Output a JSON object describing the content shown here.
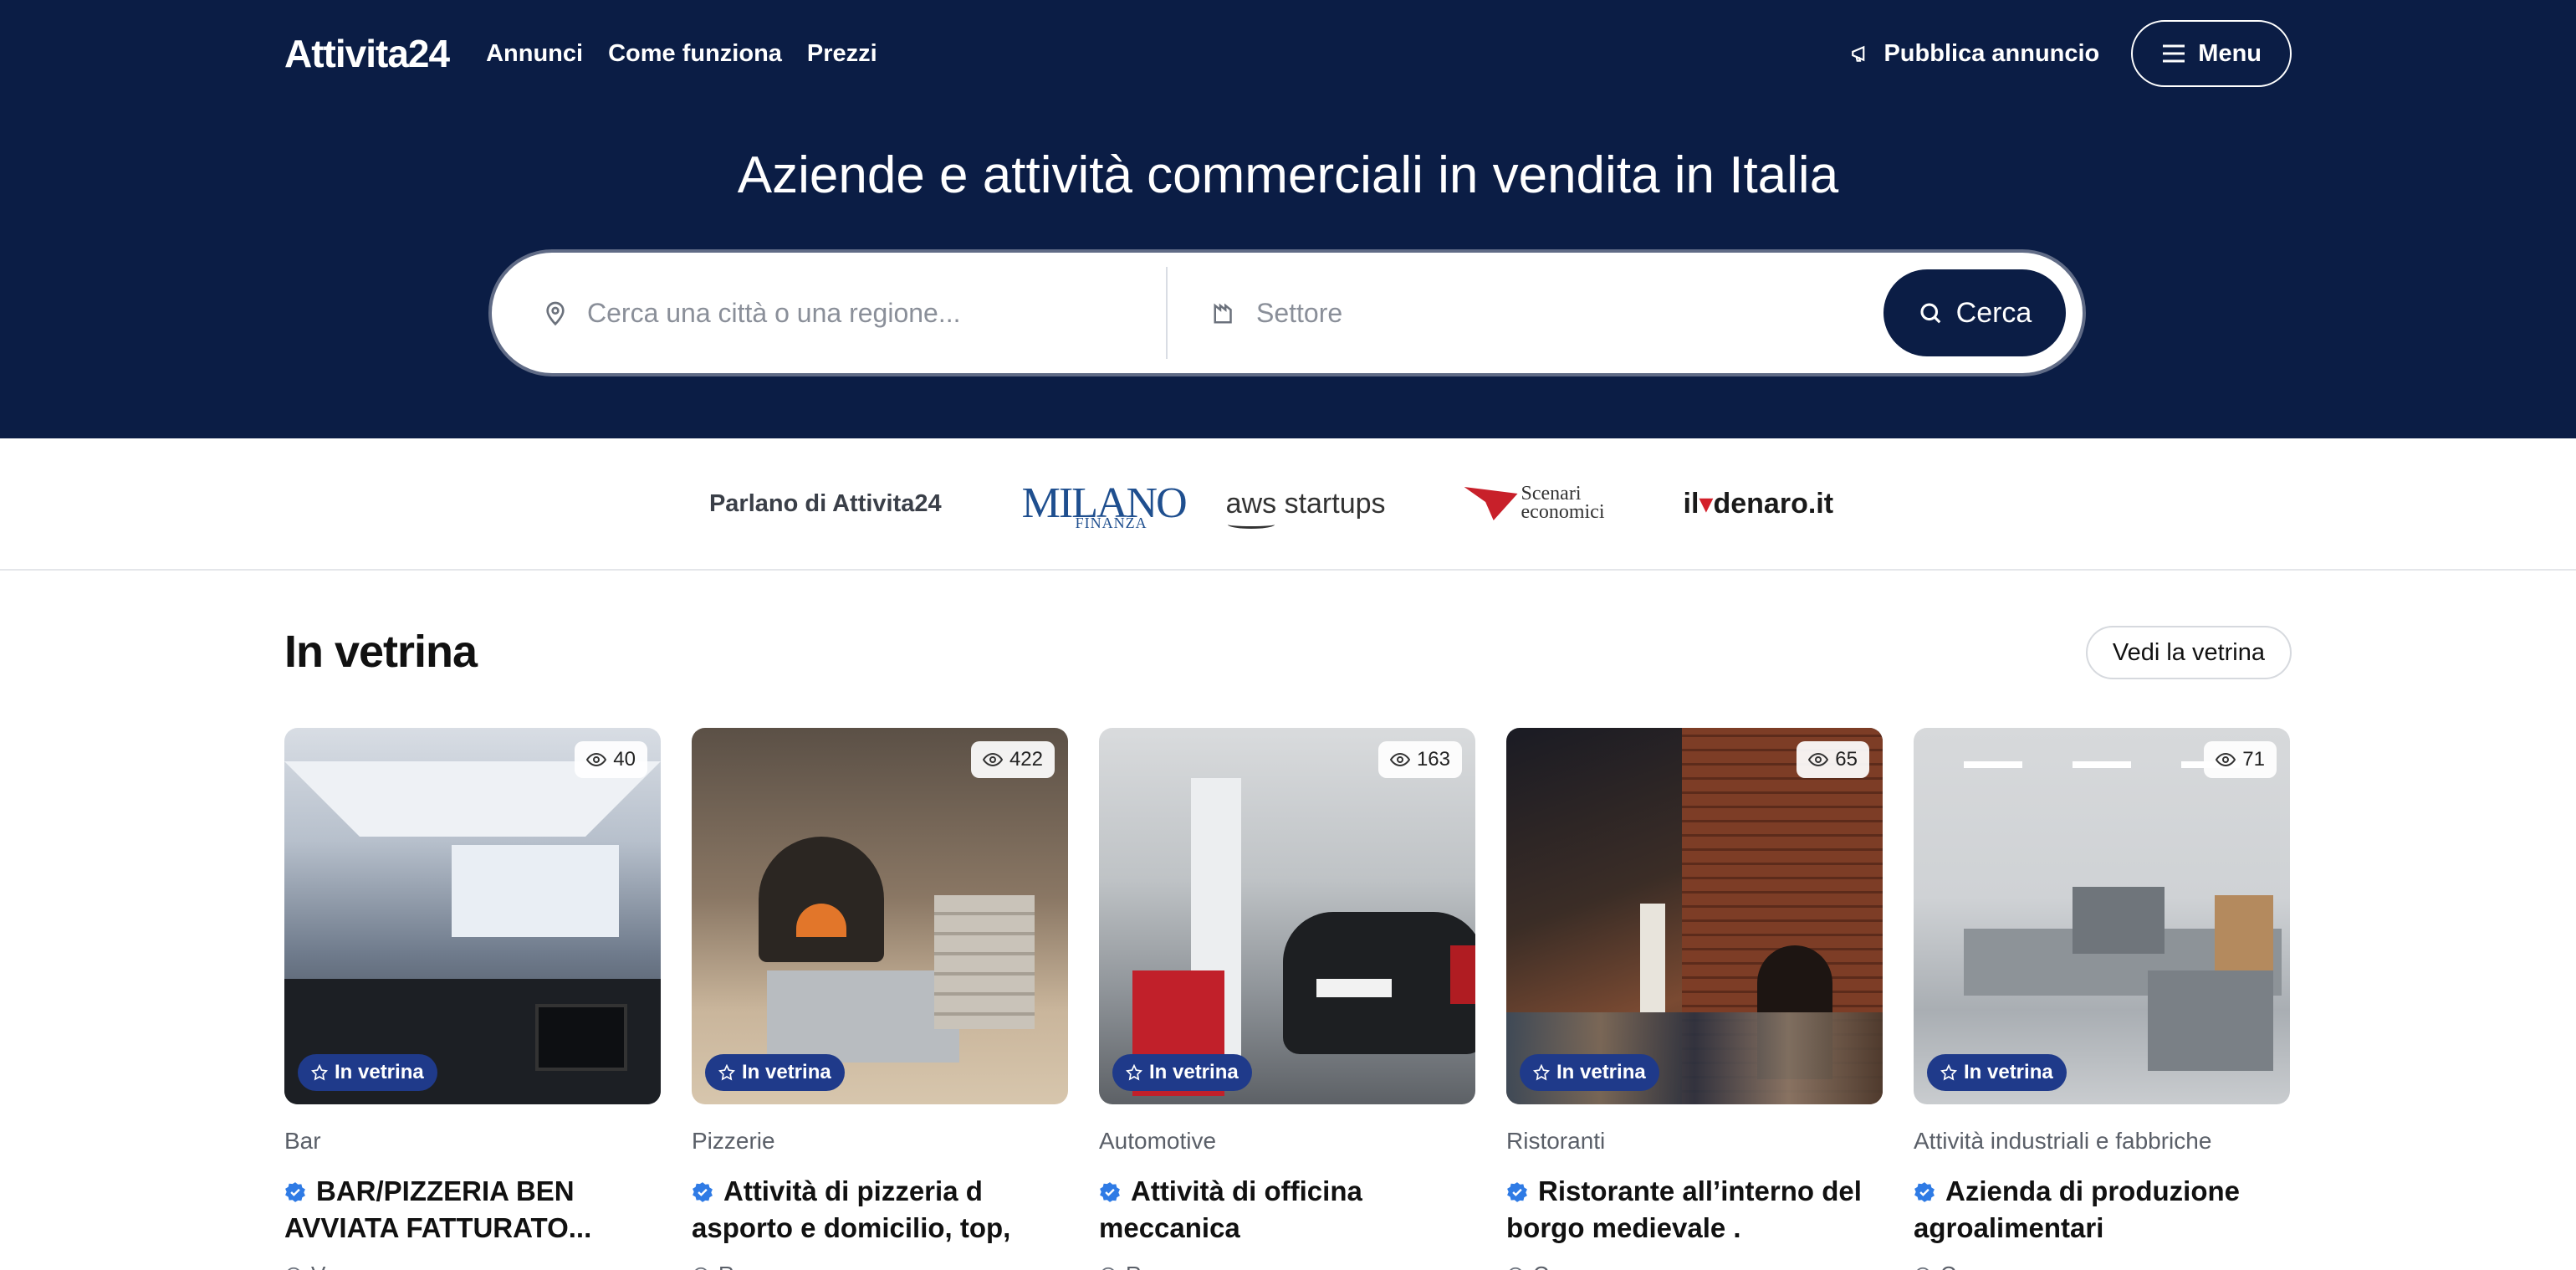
{
  "nav": {
    "logo": "Attivita24",
    "links": [
      "Annunci",
      "Come funziona",
      "Prezzi"
    ],
    "publish": "Pubblica annuncio",
    "menu": "Menu"
  },
  "hero": {
    "title": "Aziende e attività commerciali in vendita in Italia"
  },
  "search": {
    "city_placeholder": "Cerca una città o una regione...",
    "sector_placeholder": "Settore",
    "button": "Cerca"
  },
  "press": {
    "label": "Parlano di Attivita24",
    "logos": {
      "milano_main": "MILANO",
      "milano_sub": "FINANZA",
      "aws": "aws startups",
      "scenari_1": "Scenari",
      "scenari_2": "economici",
      "denaro_a": "il",
      "denaro_b": "denaro.it"
    }
  },
  "showcase": {
    "title": "In vetrina",
    "see_all": "Vedi la vetrina",
    "badge": "In vetrina",
    "cards": [
      {
        "views": "40",
        "category": "Bar",
        "title": "BAR/PIZZERIA BEN AVVIATA FATTURATO...",
        "location": "V..."
      },
      {
        "views": "422",
        "category": "Pizzerie",
        "title": "Attività di pizzeria d asporto e domicilio, top, zon...",
        "location": "R..."
      },
      {
        "views": "163",
        "category": "Automotive",
        "title": "Attività di officina meccanica",
        "location": "R..."
      },
      {
        "views": "65",
        "category": "Ristoranti",
        "title": "Ristorante all’interno del borgo medievale .",
        "location": "C..."
      },
      {
        "views": "71",
        "category": "Attività industriali e fabbriche",
        "title": "Azienda di produzione agroalimentari",
        "location": "C..."
      }
    ]
  },
  "colors": {
    "navy": "#0b1d45",
    "badge_blue": "#1f3a8a",
    "verified_blue": "#2f7be5"
  }
}
